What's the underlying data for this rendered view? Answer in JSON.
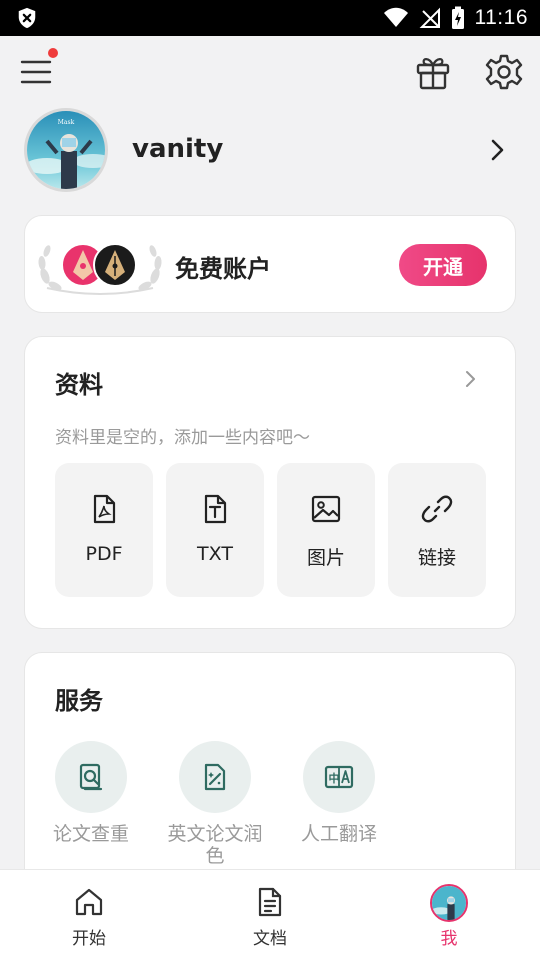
{
  "status_bar": {
    "time": "11:16",
    "icons": [
      "shield-icon",
      "wifi-icon",
      "no-signal-icon",
      "battery-charging-icon"
    ]
  },
  "header": {
    "menu_icon": "hamburger-menu-icon",
    "has_notification": true,
    "gift_icon": "gift-icon",
    "settings_icon": "gear-icon"
  },
  "profile": {
    "username": "vanity",
    "avatar_caption": "Mask"
  },
  "account": {
    "label": "免费账户",
    "open_button": "开通"
  },
  "data_section": {
    "title": "资料",
    "empty_text": "资料里是空的，添加一些内容吧～",
    "tiles": [
      {
        "label": "PDF",
        "icon": "pdf-file-icon"
      },
      {
        "label": "TXT",
        "icon": "txt-file-icon"
      },
      {
        "label": "图片",
        "icon": "image-icon"
      },
      {
        "label": "链接",
        "icon": "link-icon"
      }
    ]
  },
  "services": {
    "title": "服务",
    "items": [
      {
        "label": "论文查重",
        "icon": "plagiarism-check-icon"
      },
      {
        "label": "英文论文润色",
        "icon": "polish-icon"
      },
      {
        "label": "人工翻译",
        "icon": "translate-icon"
      }
    ]
  },
  "bottom_nav": {
    "items": [
      {
        "label": "开始",
        "icon": "home-icon"
      },
      {
        "label": "文档",
        "icon": "document-icon"
      },
      {
        "label": "我",
        "icon": "avatar",
        "active": true
      }
    ]
  },
  "colors": {
    "accent": "#e6336c",
    "background": "#f2f2f3",
    "service_icon_bg": "#e9efee",
    "service_icon_fg": "#2f6b61"
  }
}
